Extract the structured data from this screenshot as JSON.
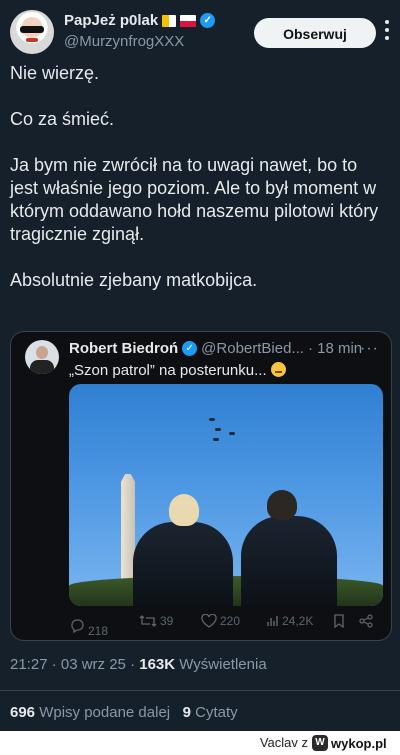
{
  "author": {
    "name": "PapJeż p0lak",
    "handle": "@MurzynfrogXXX",
    "flags": [
      "vatican-flag-icon",
      "poland-flag-icon"
    ],
    "verified": true,
    "follow_label": "Obserwuj"
  },
  "tweet": {
    "paragraphs": [
      "Nie wierzę.",
      "Co za śmieć.",
      "Ja bym nie zwrócił na to uwagi nawet, bo to jest właśnie jego poziom. Ale to był moment w którym oddawano hołd naszemu pilotowi który tragicznie zginął.",
      "Absolutnie zjebany matkobijca."
    ]
  },
  "quote": {
    "name": "Robert Biedroń",
    "handle": "@RobertBied...",
    "time": "· 18 min",
    "text": "„Szon patrol” na posterunku...",
    "actions": {
      "replies": "218",
      "reposts": "39",
      "likes": "220",
      "views": "24,2K"
    }
  },
  "meta": {
    "time": "21:27 · 03 wrz 25 ·",
    "views_count": "163K",
    "views_label": "Wyświetlenia"
  },
  "stats": {
    "reposts_count": "696",
    "reposts_label": "Wpisy podane dalej",
    "quotes_count": "9",
    "quotes_label": "Cytaty"
  },
  "watermark": {
    "user": "Vaclav z",
    "site": "wykop.pl"
  },
  "colors": {
    "background": "#15202b",
    "accent": "#1d9bf0"
  }
}
